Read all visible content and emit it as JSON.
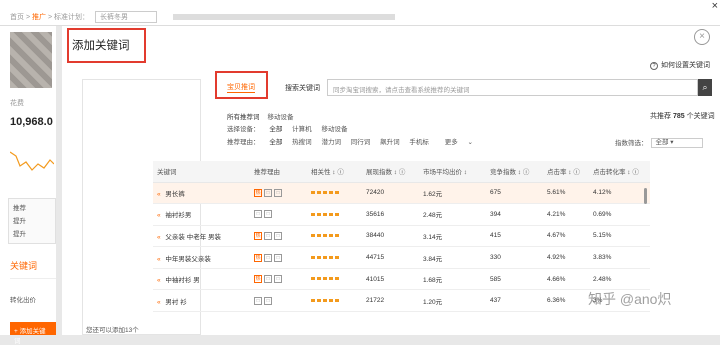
{
  "breadcrumb": {
    "home": "首页",
    "sep": ">",
    "promo": "推广",
    "plan_label": "标准计划：",
    "plan_select": "长裤冬男"
  },
  "top_close": "×",
  "left": {
    "flow_label": "花费",
    "flow_value": "10,968.0",
    "box_items": [
      "推荐",
      "提升",
      "提升"
    ],
    "keyword_title": "关键词",
    "conversion_label": "转化出价",
    "add_button": "+ 添加关键词"
  },
  "modal": {
    "title": "添加关键词",
    "close": "×",
    "help_text": "如何设置关键词",
    "selected_footer": "您还可以添加13个",
    "tabs": {
      "recommended": "宝贝推词",
      "search": "搜索关键词"
    },
    "search_placeholder": "同步淘宝词搜索，请点击查看系统推荐的关键词",
    "search_icon": "magnifier-icon",
    "filters": {
      "row1": [
        "所有推荐词",
        "移动设备"
      ],
      "row2_label": "选择设备：",
      "row2": [
        "全部",
        "计算机",
        "移动设备"
      ],
      "row3_label": "推荐理由：",
      "row3": [
        "全部",
        "热搜词",
        "潜力词",
        "同行词",
        "飙升词",
        "手机标",
        "更多"
      ]
    },
    "total": {
      "prefix": "共推荐",
      "count": "785",
      "suffix": "个关键词"
    },
    "sort": {
      "label": "指数筛选：",
      "value": "全部"
    },
    "columns": [
      "关键词",
      "推荐理由",
      "相关性",
      "展现指数",
      "市场平均出价",
      "竞争指数",
      "点击率",
      "点击转化率"
    ],
    "rows": [
      {
        "keyword": "男长裤",
        "reasons": [
          "o",
          "g",
          "g"
        ],
        "impressions": "72420",
        "avg_bid": "1.62元",
        "competition": "675",
        "ctr": "5.61%",
        "cvr": "4.12%"
      },
      {
        "keyword": "袖衬衫男",
        "reasons": [
          "g",
          "g"
        ],
        "impressions": "35616",
        "avg_bid": "2.48元",
        "competition": "394",
        "ctr": "4.21%",
        "cvr": "0.69%"
      },
      {
        "keyword": "父亲装 中老年 男装",
        "reasons": [
          "o",
          "g",
          "g"
        ],
        "impressions": "38440",
        "avg_bid": "3.14元",
        "competition": "415",
        "ctr": "4.67%",
        "cvr": "5.15%"
      },
      {
        "keyword": "中年男装父亲装",
        "reasons": [
          "o",
          "g",
          "g"
        ],
        "impressions": "44715",
        "avg_bid": "3.84元",
        "competition": "330",
        "ctr": "4.92%",
        "cvr": "3.83%"
      },
      {
        "keyword": "中袖衬衫 男",
        "reasons": [
          "o",
          "g",
          "g"
        ],
        "impressions": "41015",
        "avg_bid": "1.68元",
        "competition": "585",
        "ctr": "4.66%",
        "cvr": "2.48%"
      },
      {
        "keyword": "男衬 衫",
        "reasons": [
          "g",
          "g"
        ],
        "impressions": "21722",
        "avg_bid": "1.20元",
        "competition": "437",
        "ctr": "6.36%",
        "cvr": "3%"
      }
    ]
  },
  "watermark": "知乎 @ano炽"
}
